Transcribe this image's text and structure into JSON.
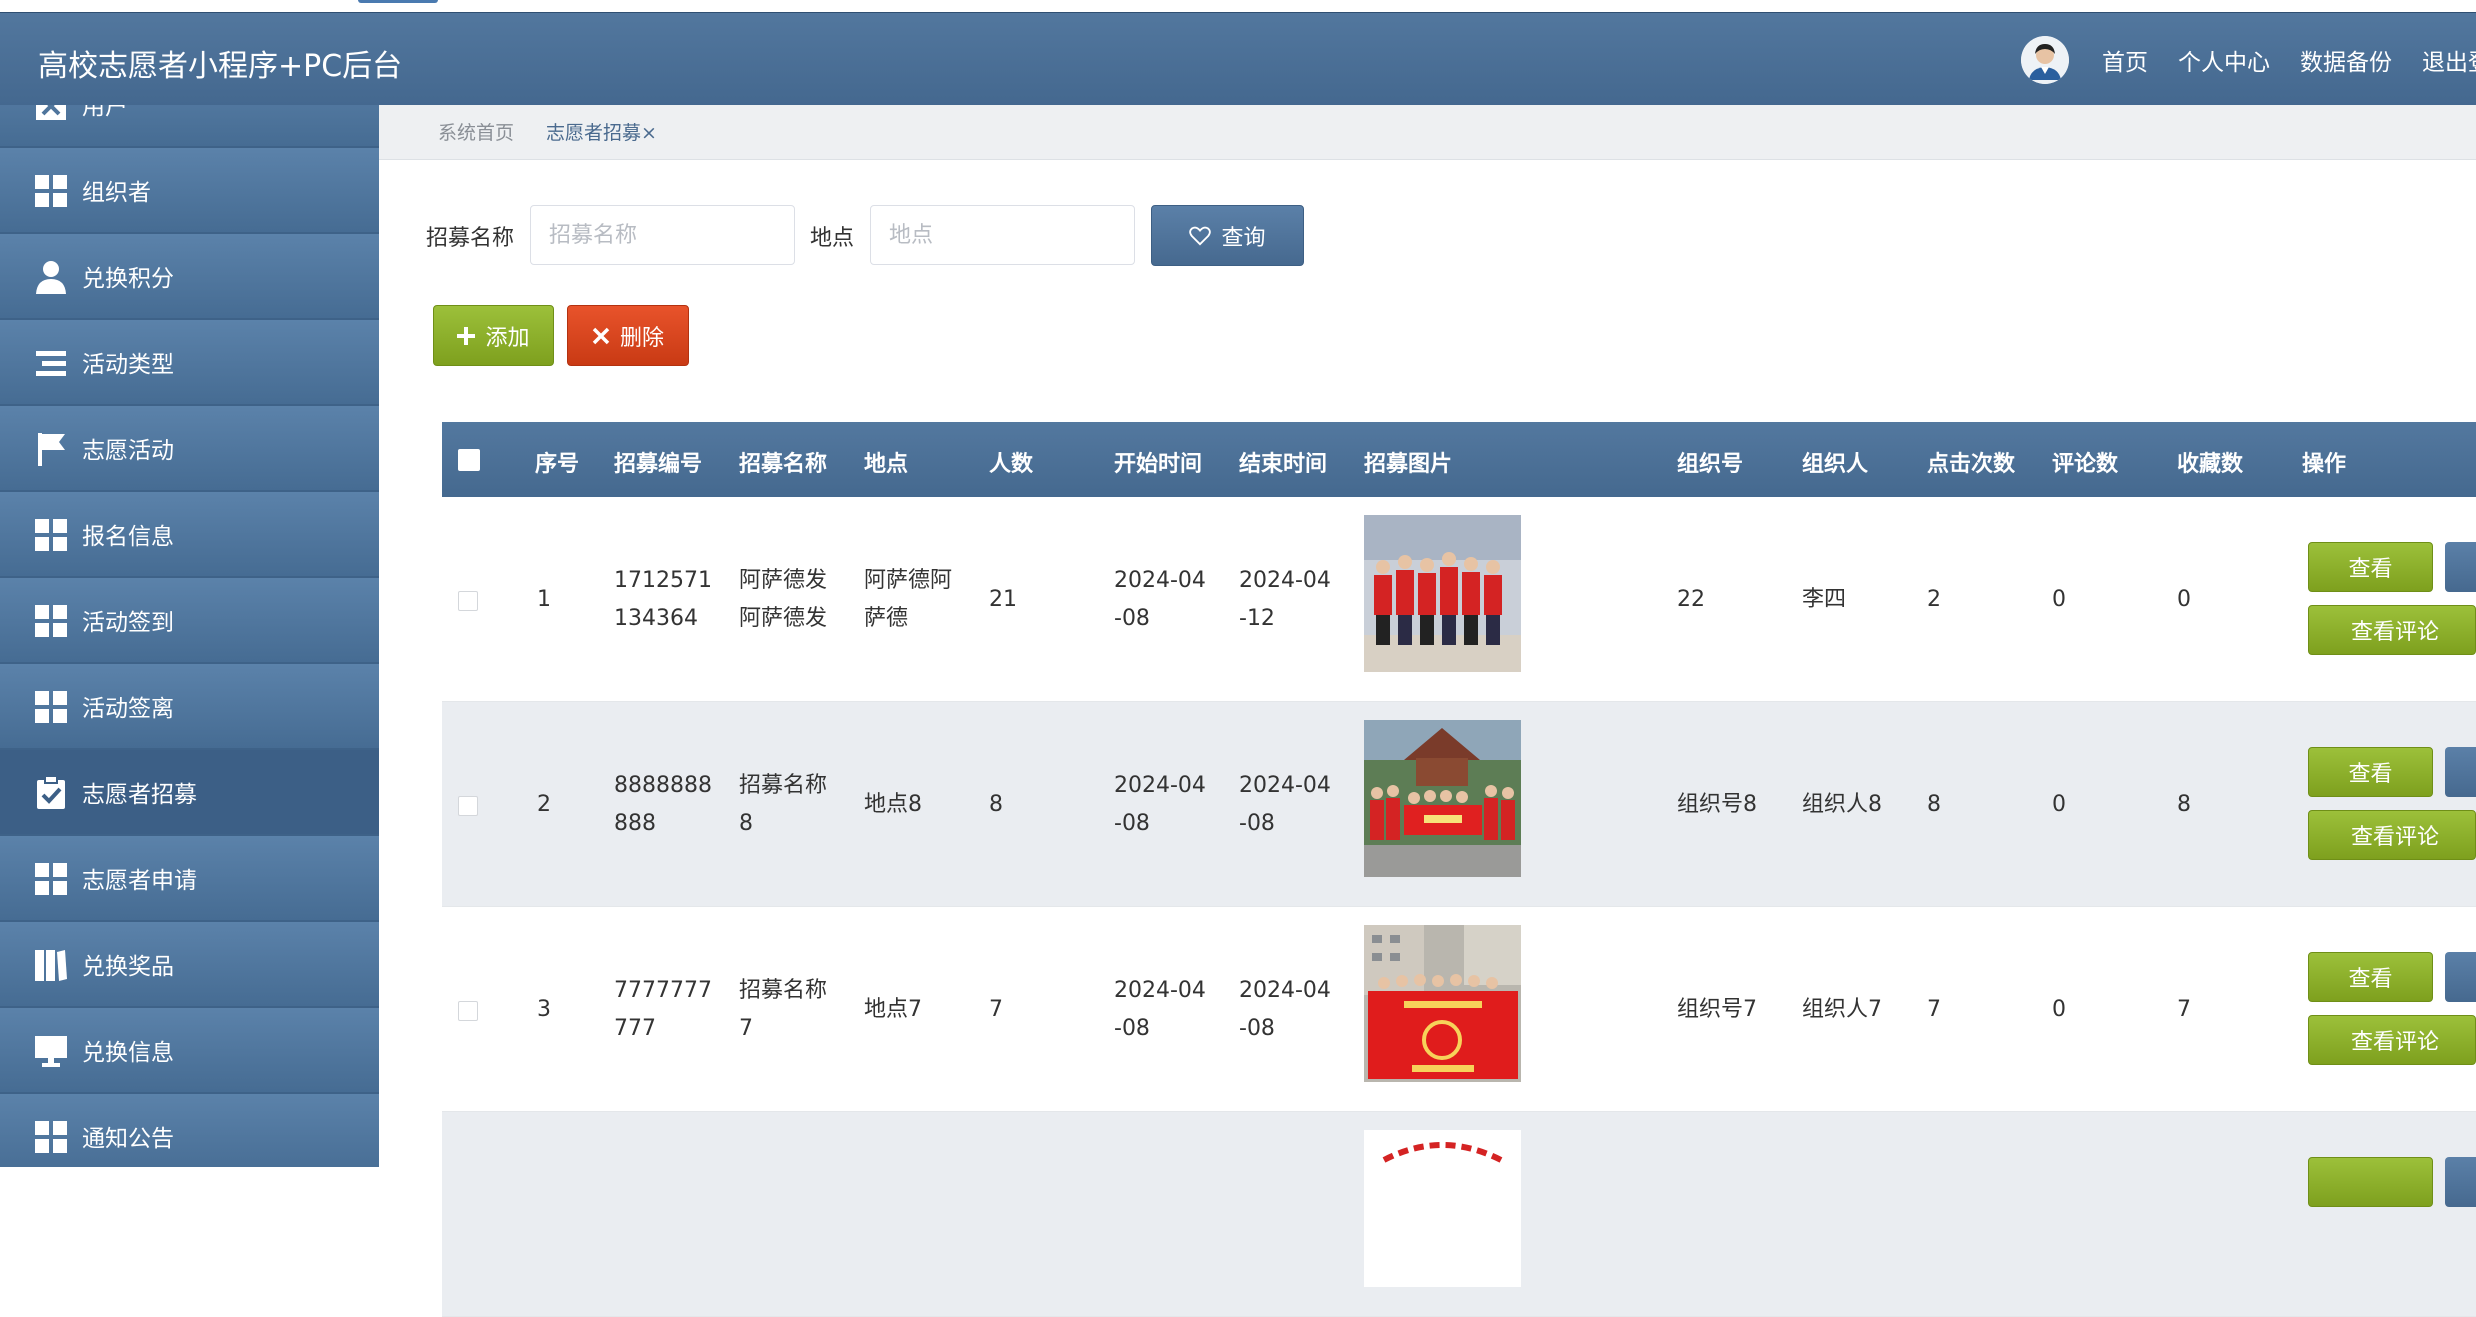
{
  "header": {
    "title": "高校志愿者小程序+PC后台"
  },
  "nav": [
    "首页",
    "个人中心",
    "数据备份",
    "退出登"
  ],
  "sidebar": [
    {
      "label": "用户",
      "icon": "user-check-icon",
      "active": false
    },
    {
      "label": "组织者",
      "icon": "grid-icon",
      "active": false
    },
    {
      "label": "兑换积分",
      "icon": "person-icon",
      "active": false
    },
    {
      "label": "活动类型",
      "icon": "list-icon",
      "active": false
    },
    {
      "label": "志愿活动",
      "icon": "flag-icon",
      "active": false
    },
    {
      "label": "报名信息",
      "icon": "grid-icon",
      "active": false
    },
    {
      "label": "活动签到",
      "icon": "grid-icon",
      "active": false
    },
    {
      "label": "活动签离",
      "icon": "grid-icon",
      "active": false
    },
    {
      "label": "志愿者招募",
      "icon": "clipboard-check-icon",
      "active": true
    },
    {
      "label": "志愿者申请",
      "icon": "grid-icon",
      "active": false
    },
    {
      "label": "兑换奖品",
      "icon": "book-icon",
      "active": false
    },
    {
      "label": "兑换信息",
      "icon": "monitor-icon",
      "active": false
    },
    {
      "label": "通知公告",
      "icon": "grid-icon",
      "active": false
    }
  ],
  "breadcrumb": {
    "home": "系统首页",
    "current": "志愿者招募×"
  },
  "search": {
    "name_label": "招募名称",
    "name_placeholder": "招募名称",
    "place_label": "地点",
    "place_placeholder": "地点",
    "query_label": "查询"
  },
  "actions": {
    "add_label": "添加",
    "delete_label": "删除"
  },
  "table": {
    "columns": [
      "序号",
      "招募编号",
      "招募名称",
      "地点",
      "人数",
      "开始时间",
      "结束时间",
      "招募图片",
      "组织号",
      "组织人",
      "点击次数",
      "评论数",
      "收藏数",
      "操作"
    ],
    "rows": [
      {
        "index": "1",
        "code": [
          "1712571",
          "134364"
        ],
        "name": [
          "阿萨德发",
          "阿萨德发"
        ],
        "place": [
          "阿萨德阿",
          "萨德"
        ],
        "people": "21",
        "start": [
          "2024-04",
          "-08"
        ],
        "end": [
          "2024-04",
          "-12"
        ],
        "org_no": "22",
        "organizer": "李四",
        "clicks": "2",
        "comments": "0",
        "favorites": "0"
      },
      {
        "index": "2",
        "code": [
          "8888888",
          "888"
        ],
        "name": [
          "招募名称",
          "8"
        ],
        "place": [
          "地点8"
        ],
        "people": "8",
        "start": [
          "2024-04",
          "-08"
        ],
        "end": [
          "2024-04",
          "-08"
        ],
        "org_no": "组织号8",
        "organizer": "组织人8",
        "clicks": "8",
        "comments": "0",
        "favorites": "8"
      },
      {
        "index": "3",
        "code": [
          "7777777",
          "777"
        ],
        "name": [
          "招募名称",
          "7"
        ],
        "place": [
          "地点7"
        ],
        "people": "7",
        "start": [
          "2024-04",
          "-08"
        ],
        "end": [
          "2024-04",
          "-08"
        ],
        "org_no": "组织号7",
        "organizer": "组织人7",
        "clicks": "7",
        "comments": "0",
        "favorites": "7"
      }
    ],
    "row_buttons": {
      "view": "查看",
      "comment": "查看评论"
    }
  },
  "colors": {
    "header": "#4a6f96",
    "sidebar": "#4f759c",
    "green": "#8db52c",
    "red": "#d9441d",
    "accent": "#4a6a8e"
  }
}
